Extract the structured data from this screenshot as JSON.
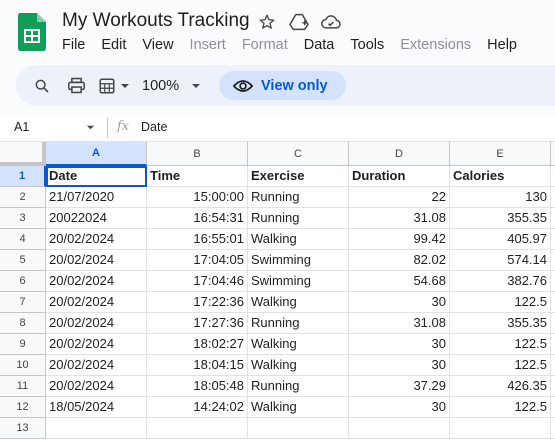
{
  "app": {
    "doc_title": "My Workouts Tracking",
    "accent": "#0b57d0",
    "logo_color": "#0f9d58"
  },
  "menu": [
    "File",
    "Edit",
    "View",
    "Insert",
    "Format",
    "Data",
    "Tools",
    "Extensions",
    "Help"
  ],
  "menu_disabled": [
    "Insert",
    "Format",
    "Extensions"
  ],
  "toolbar": {
    "zoom": "100%",
    "view_only_label": "View only",
    "icons": [
      "search-icon",
      "print-icon",
      "format-icon",
      "chevron-down-icon",
      "eye-icon"
    ]
  },
  "formula_bar": {
    "cell_ref": "A1",
    "fx": "fx",
    "content": "Date"
  },
  "sheet": {
    "columns": [
      "A",
      "B",
      "C",
      "D",
      "E"
    ],
    "rows": [
      "1",
      "2",
      "3",
      "4",
      "5",
      "6",
      "7",
      "8",
      "9",
      "10",
      "11",
      "12",
      "13"
    ],
    "selected_cell": "A1",
    "cells": [
      [
        "Date",
        "Time",
        "Exercise",
        "Duration",
        "Calories"
      ],
      [
        "21/07/2020",
        "15:00:00",
        "Running",
        "22",
        "130"
      ],
      [
        "20022024",
        "16:54:31",
        "Running",
        "31.08",
        "355.35"
      ],
      [
        "20/02/2024",
        "16:55:01",
        "Walking",
        "99.42",
        "405.97"
      ],
      [
        "20/02/2024",
        "17:04:05",
        "Swimming",
        "82.02",
        "574.14"
      ],
      [
        "20/02/2024",
        "17:04:46",
        "Swimming",
        "54.68",
        "382.76"
      ],
      [
        "20/02/2024",
        "17:22:36",
        "Walking",
        "30",
        "122.5"
      ],
      [
        "20/02/2024",
        "17:27:36",
        "Running",
        "31.08",
        "355.35"
      ],
      [
        "20/02/2024",
        "18:02:27",
        "Walking",
        "30",
        "122.5"
      ],
      [
        "20/02/2024",
        "18:04:15",
        "Walking",
        "30",
        "122.5"
      ],
      [
        "20/02/2024",
        "18:05:48",
        "Running",
        "37.29",
        "426.35"
      ],
      [
        "18/05/2024",
        "14:24:02",
        "Walking",
        "30",
        "122.5"
      ],
      [
        "",
        "",
        "",
        "",
        ""
      ]
    ]
  }
}
